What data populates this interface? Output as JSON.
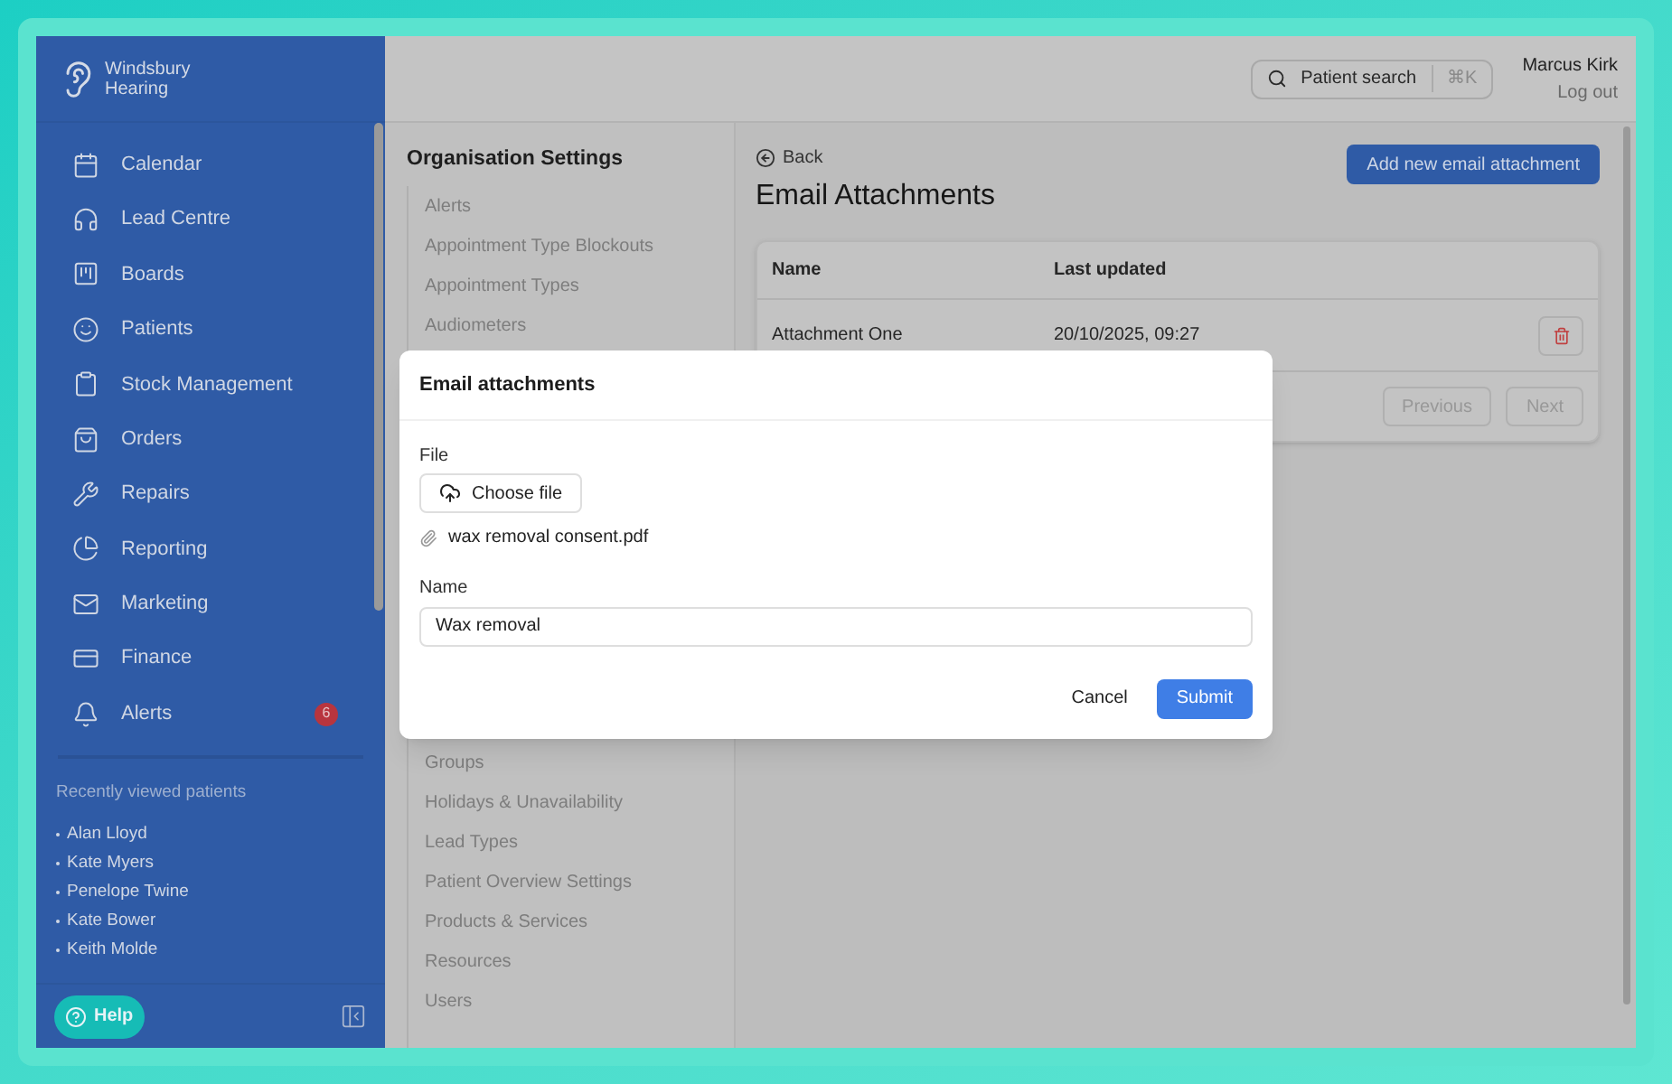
{
  "brand": {
    "name": "Windsbury",
    "subname": "Hearing"
  },
  "nav": [
    {
      "label": "Calendar"
    },
    {
      "label": "Lead Centre"
    },
    {
      "label": "Boards"
    },
    {
      "label": "Patients"
    },
    {
      "label": "Stock Management"
    },
    {
      "label": "Orders"
    },
    {
      "label": "Repairs"
    },
    {
      "label": "Reporting"
    },
    {
      "label": "Marketing"
    },
    {
      "label": "Finance"
    },
    {
      "label": "Alerts",
      "badge": "6"
    }
  ],
  "recent": {
    "title": "Recently viewed patients",
    "patients": [
      "Alan Lloyd",
      "Kate Myers",
      "Penelope Twine",
      "Kate Bower",
      "Keith Molde"
    ]
  },
  "help": "Help",
  "header": {
    "search": "Patient search",
    "shortcut": "⌘K",
    "user": "Marcus Kirk",
    "logout": "Log out"
  },
  "settings": {
    "title": "Organisation Settings",
    "items_top": [
      "Alerts",
      "Appointment Type Blockouts",
      "Appointment Types",
      "Audiometers"
    ],
    "items_bottom": [
      "Groups",
      "Holidays & Unavailability",
      "Lead Types",
      "Patient Overview Settings",
      "Products & Services",
      "Resources",
      "Users"
    ]
  },
  "page": {
    "back": "Back",
    "title": "Email Attachments",
    "add": "Add new email attachment",
    "columns": [
      "Name",
      "Last updated"
    ],
    "rows": [
      {
        "name": "Attachment One",
        "updated": "20/10/2025, 09:27"
      }
    ],
    "previous": "Previous",
    "next": "Next"
  },
  "modal": {
    "title": "Email attachments",
    "file_label": "File",
    "choose": "Choose file",
    "filename": "wax removal consent.pdf",
    "name_label": "Name",
    "name_value": "Wax removal",
    "cancel": "Cancel",
    "submit": "Submit"
  }
}
